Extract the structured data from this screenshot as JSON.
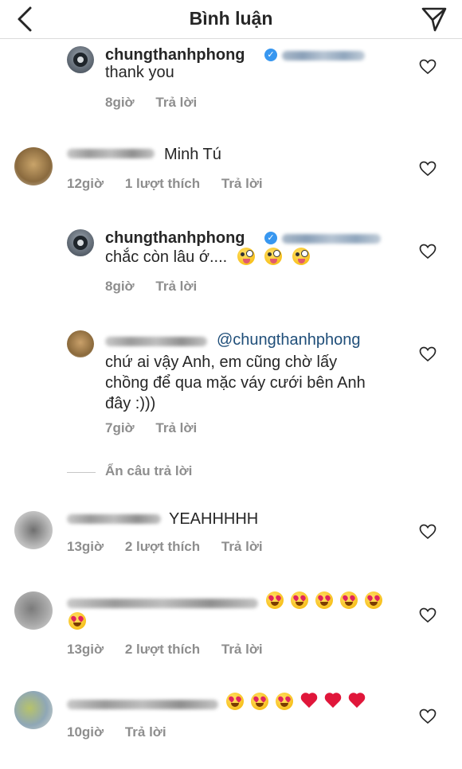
{
  "header": {
    "title": "Bình luận"
  },
  "comments": [
    {
      "username": "chungthanhphong",
      "text": "thank you",
      "time": "8giờ",
      "reply": "Trả lời"
    },
    {
      "text": "Minh Tú",
      "time": "12giờ",
      "likes": "1 lượt thích",
      "reply": "Trả lời"
    },
    {
      "username": "chungthanhphong",
      "text": "chắc còn lâu ớ....",
      "time": "8giờ",
      "reply": "Trả lời"
    },
    {
      "mention": "@chungthanhphong",
      "text_line1": "chứ ai vậy Anh, em cũng chờ lấy",
      "text_line2": "chồng để qua mặc váy cưới bên Anh",
      "text_line3": "đây :)))",
      "time": "7giờ",
      "reply": "Trả lời"
    },
    {
      "text": "YEAHHHHH",
      "time": "13giờ",
      "likes": "2 lượt thích",
      "reply": "Trả lời"
    },
    {
      "time": "13giờ",
      "likes": "2 lượt thích",
      "reply": "Trả lời"
    },
    {
      "time": "10giờ",
      "reply": "Trả lời"
    }
  ],
  "hide_replies": "Ẩn câu trả lời",
  "icons": {
    "back": "chevron-left-icon",
    "send": "paper-plane-icon",
    "like": "heart-outline-icon",
    "verified": "verified-badge-icon"
  },
  "colors": {
    "verified": "#3897f0",
    "mention": "#1f4e79",
    "meta": "#8e8e8e"
  }
}
